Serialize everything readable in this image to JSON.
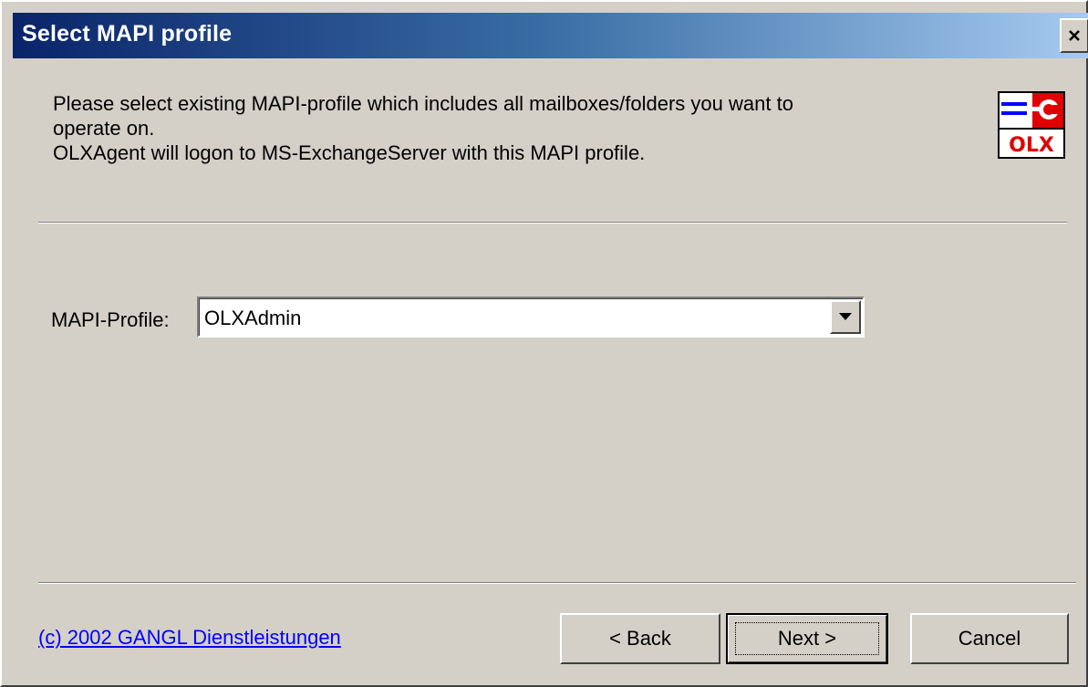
{
  "window": {
    "title": "Select MAPI profile",
    "close_label": "×"
  },
  "header": {
    "description_line1": "Please select existing MAPI-profile which includes all mailboxes/folders you want to",
    "description_line2": "operate on.",
    "description_line3": "OLXAgent will logon to MS-ExchangeServer with this MAPI profile.",
    "logo_text": "OLX",
    "logo_icon": "olx-wrench-logo-icon"
  },
  "form": {
    "profile_label": "MAPI-Profile:",
    "profile_value": "OLXAdmin"
  },
  "footer": {
    "copyright_link": "(c) 2002 GANGL Dienstleistungen",
    "back_label": "< Back",
    "next_label": "Next >",
    "cancel_label": "Cancel"
  },
  "colors": {
    "dialog_bg": "#d4d0c8",
    "title_gradient_start": "#0a246a",
    "title_gradient_end": "#a6caf0",
    "link": "#0000ff",
    "logo_red": "#e00000",
    "logo_blue": "#0000ff"
  }
}
